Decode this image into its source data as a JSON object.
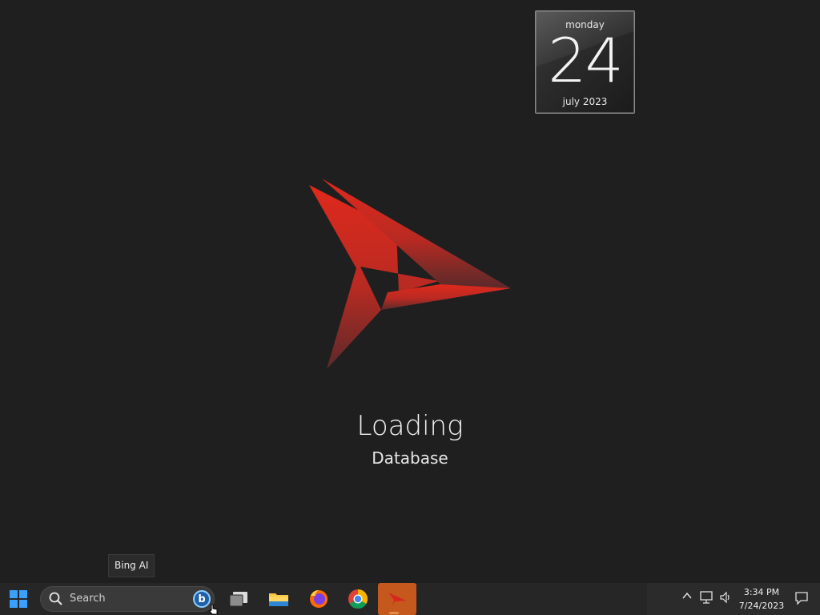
{
  "calendar": {
    "weekday": "monday",
    "day": "24",
    "month_year": "july 2023"
  },
  "loading": {
    "title": "Loading",
    "subtitle": "Database"
  },
  "tooltip": {
    "text": "Bing AI"
  },
  "taskbar": {
    "search_placeholder": "Search",
    "apps": [
      "start-icon",
      "task-view-icon",
      "file-explorer-icon",
      "firefox-icon",
      "chrome-icon",
      "loading-app-icon"
    ],
    "accent_color": "#c4581d"
  },
  "tray": {
    "time": "3:34 PM",
    "date": "7/24/2023"
  },
  "colors": {
    "desktop_bg": "#1f1f20",
    "logo_red": "#d7261d"
  }
}
